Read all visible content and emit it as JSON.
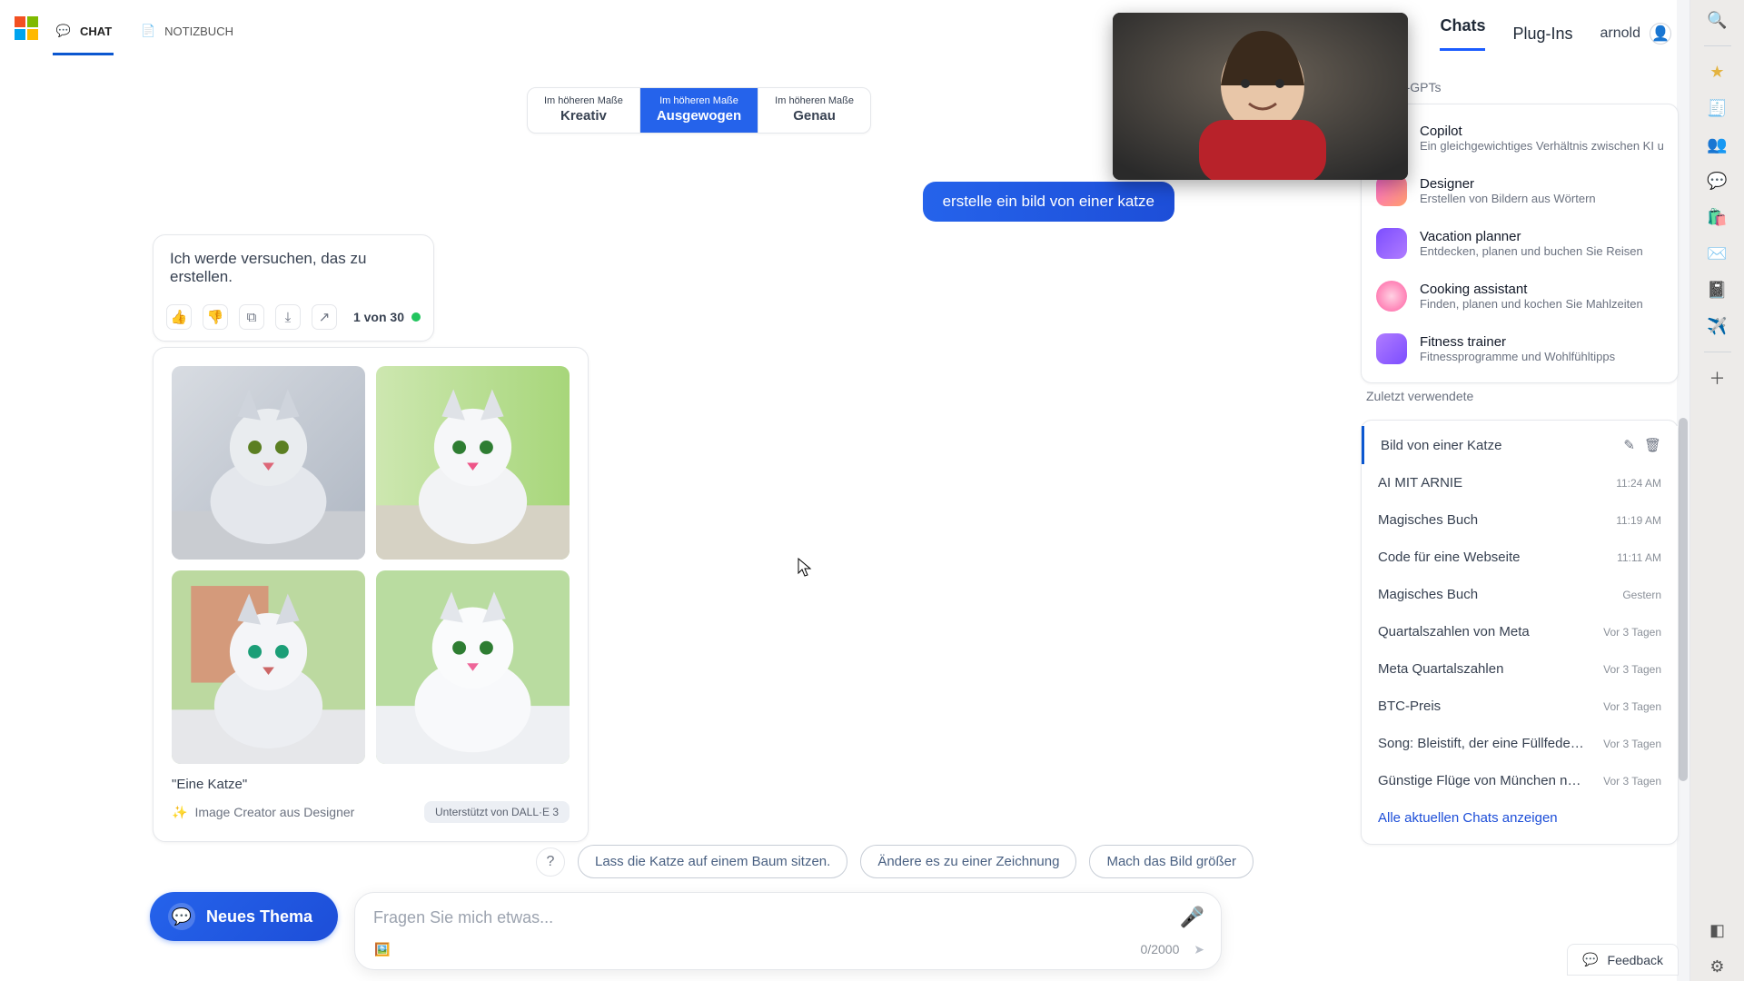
{
  "header": {
    "tabs": {
      "chat": "CHAT",
      "notebook": "NOTIZBUCH"
    },
    "rightLinks": {
      "chats": "Chats",
      "plugins": "Plug-Ins"
    },
    "userName": "arnold"
  },
  "styleSelect": {
    "top": "Im höheren Maße",
    "creative": "Kreativ",
    "balanced": "Ausgewogen",
    "precise": "Genau"
  },
  "userMessage": "erstelle ein bild von einer katze",
  "assistant": {
    "text": "Ich werde versuchen, das zu erstellen.",
    "counter": "1 von 30"
  },
  "imageCard": {
    "caption": "\"Eine Katze\"",
    "source": "Image Creator aus Designer",
    "poweredBy": "Unterstützt von DALL·E 3"
  },
  "suggestions": [
    "Lass die Katze auf einem Baum sitzen.",
    "Ändere es zu einer Zeichnung",
    "Mach das Bild größer"
  ],
  "composer": {
    "newTopic": "Neues Thema",
    "placeholder": "Fragen Sie mich etwas...",
    "counter": "0/2000"
  },
  "rightPanel": {
    "gptHeading": "Copilot-GPTs",
    "gpts": [
      {
        "name": "Copilot",
        "sub": "Ein gleichgewichtiges Verhältnis zwischen KI u",
        "color": "conic-gradient(#3ecf8e,#2b7fff,#ff7ab6,#ffb02e,#3ecf8e)"
      },
      {
        "name": "Designer",
        "sub": "Erstellen von Bildern aus Wörtern",
        "color": "linear-gradient(135deg,#ff6bd6,#ff9f6b)"
      },
      {
        "name": "Vacation planner",
        "sub": "Entdecken, planen und buchen Sie Reisen",
        "color": "linear-gradient(135deg,#7c4dff,#b07cff)"
      },
      {
        "name": "Cooking assistant",
        "sub": "Finden, planen und kochen Sie Mahlzeiten",
        "color": "radial-gradient(circle,#ff9ec4,#ff5fa2)"
      },
      {
        "name": "Fitness trainer",
        "sub": "Fitnessprogramme und Wohlfühltipps",
        "color": "linear-gradient(135deg,#b07cff,#7c4dff)"
      }
    ],
    "recentHeading": "Zuletzt verwendete",
    "recents": [
      {
        "t": "Bild von einer Katze",
        "ts": "",
        "active": true
      },
      {
        "t": "AI MIT ARNIE",
        "ts": "11:24 AM"
      },
      {
        "t": "Magisches Buch",
        "ts": "11:19 AM"
      },
      {
        "t": "Code für eine Webseite",
        "ts": "11:11 AM"
      },
      {
        "t": "Magisches Buch",
        "ts": "Gestern"
      },
      {
        "t": "Quartalszahlen von Meta",
        "ts": "Vor 3 Tagen"
      },
      {
        "t": "Meta Quartalszahlen",
        "ts": "Vor 3 Tagen"
      },
      {
        "t": "BTC-Preis",
        "ts": "Vor 3 Tagen"
      },
      {
        "t": "Song: Bleistift, der eine Füllfeder sein m",
        "ts": "Vor 3 Tagen"
      },
      {
        "t": "Günstige Flüge von München nach Fra",
        "ts": "Vor 3 Tagen"
      }
    ],
    "viewAll": "Alle aktuellen Chats anzeigen"
  },
  "feedback": "Feedback",
  "edgeIcons": [
    "search",
    "favorites",
    "collections",
    "people",
    "chat",
    "shopping",
    "outlook",
    "onenote",
    "send"
  ]
}
